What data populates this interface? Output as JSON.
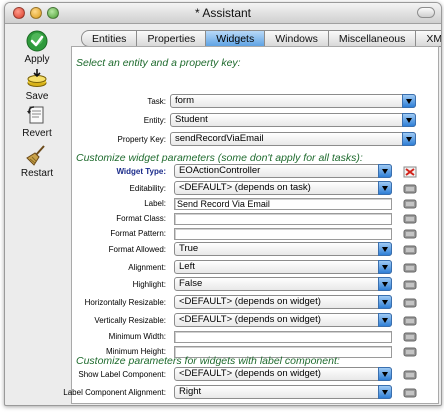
{
  "window": {
    "title": "* Assistant"
  },
  "sidebar": {
    "items": [
      {
        "label": "Apply",
        "icon": "apply-checkmark-icon"
      },
      {
        "label": "Save",
        "icon": "save-disk-icon"
      },
      {
        "label": "Revert",
        "icon": "revert-document-icon"
      },
      {
        "label": "Restart",
        "icon": "restart-broom-icon"
      }
    ]
  },
  "tabs": [
    {
      "label": "Entities",
      "active": false
    },
    {
      "label": "Properties",
      "active": false
    },
    {
      "label": "Widgets",
      "active": true
    },
    {
      "label": "Windows",
      "active": false
    },
    {
      "label": "Miscellaneous",
      "active": false
    },
    {
      "label": "XML",
      "active": false
    }
  ],
  "colors": {
    "section_text": "#1f6b2e",
    "tab_active": "#5fa3e4",
    "popup_arrow": "#2f7fd6",
    "widget_type_label": "#1a2b8a"
  },
  "sections": {
    "select_entity": "Select an entity and a property key:",
    "customize_widget": "Customize widget parameters (some don't apply for all tasks):",
    "customize_label": "Customize parameters for widgets with label component:"
  },
  "selection": {
    "task": {
      "label": "Task:",
      "value": "form"
    },
    "entity": {
      "label": "Entity:",
      "value": "Student"
    },
    "property_key": {
      "label": "Property Key:",
      "value": "sendRecordViaEmail"
    }
  },
  "widget_params": [
    {
      "label": "Widget Type:",
      "value": "EOActionController",
      "kind": "popup"
    },
    {
      "label": "Editability:",
      "value": "<DEFAULT> (depends on task)",
      "kind": "popup"
    },
    {
      "label": "Label:",
      "value": "Send Record Via Email",
      "kind": "text"
    },
    {
      "label": "Format Class:",
      "value": "",
      "kind": "text"
    },
    {
      "label": "Format Pattern:",
      "value": "",
      "kind": "text"
    },
    {
      "label": "Format Allowed:",
      "value": "True",
      "kind": "popup"
    },
    {
      "label": "Alignment:",
      "value": "Left",
      "kind": "popup"
    },
    {
      "label": "Highlight:",
      "value": "False",
      "kind": "popup"
    },
    {
      "label": "Horizontally Resizable:",
      "value": "<DEFAULT> (depends on widget)",
      "kind": "popup"
    },
    {
      "label": "Vertically Resizable:",
      "value": "<DEFAULT> (depends on widget)",
      "kind": "popup"
    },
    {
      "label": "Minimum Width:",
      "value": "",
      "kind": "text"
    },
    {
      "label": "Minimum Height:",
      "value": "",
      "kind": "text"
    }
  ],
  "label_params": [
    {
      "label": "Show Label Component:",
      "value": "<DEFAULT> (depends on widget)",
      "kind": "popup"
    },
    {
      "label": "Label Component Alignment:",
      "value": "Right",
      "kind": "popup"
    }
  ]
}
